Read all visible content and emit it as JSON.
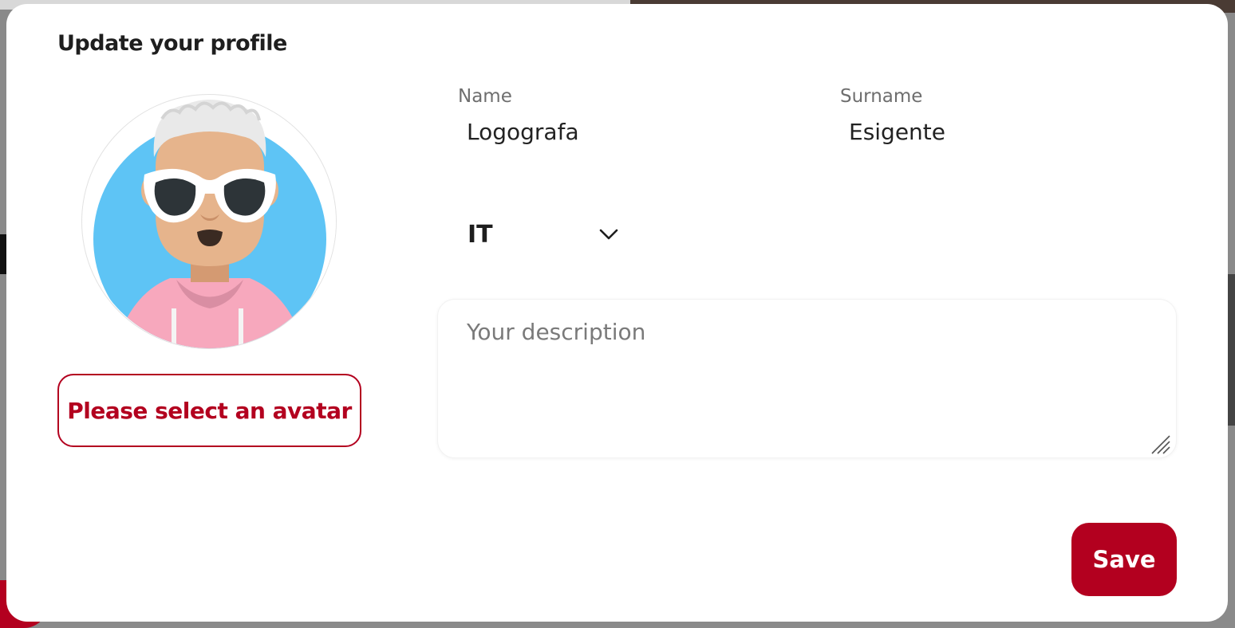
{
  "dialog": {
    "title": "Update your profile"
  },
  "avatar": {
    "button_label": "Please select an avatar",
    "icon": "avatar-image",
    "background_color": "#5ec4f5"
  },
  "form": {
    "name": {
      "label": "Name",
      "value": "Logografa"
    },
    "surname": {
      "label": "Surname",
      "value": "Esigente"
    },
    "language": {
      "selected": "IT",
      "icon": "chevron-down-icon"
    },
    "description": {
      "placeholder": "Your description",
      "value": ""
    }
  },
  "actions": {
    "save_label": "Save"
  },
  "colors": {
    "accent": "#b3001f",
    "backdrop": "#8a8a8a"
  }
}
